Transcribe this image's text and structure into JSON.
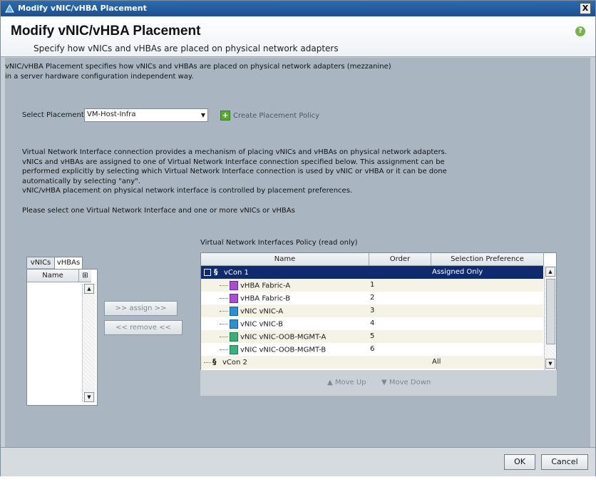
{
  "window": {
    "title": "Modify vNIC/vHBA Placement",
    "close_label": "X"
  },
  "header": {
    "title": "Modify vNIC/vHBA Placement",
    "subtitle": "Specify how vNICs and vHBAs are placed on physical network adapters",
    "help_label": "?"
  },
  "intro": {
    "line1": "vNIC/vHBA Placement specifies how vNICs and vHBAs are placed on physical network adapters (mezzanine)",
    "line2": "in a server hardware configuration independent way."
  },
  "placement": {
    "label": "Select Placement:",
    "selected": "VM-Host-Infra",
    "create_label": "Create Placement Policy"
  },
  "description": {
    "lines": [
      "Virtual Network Interface connection provides a mechanism of placing vNICs and vHBAs on physical network adapters.",
      "vNICs and vHBAs are assigned to one of Virtual Network Interface connection specified below. This assignment can be",
      "performed explicitly by selecting which Virtual Network Interface connection is used by vNIC or vHBA or it can be done",
      "automatically by selecting \"any\".",
      "vNIC/vHBA placement on physical network interface is controlled by placement preferences."
    ],
    "instruction": "Please select one Virtual Network Interface and one or more vNICs or vHBAs"
  },
  "left_panel": {
    "tabs": [
      "vNICs",
      "vHBAs"
    ],
    "active_tab": "vHBAs",
    "column_name": "Name"
  },
  "buttons": {
    "assign": ">> assign >>",
    "remove": "<< remove <<"
  },
  "vni_table": {
    "title": "Virtual Network Interfaces Policy (read only)",
    "columns": [
      "Name",
      "Order",
      "Selection Preference"
    ],
    "rows": [
      {
        "name": "vCon 1",
        "order": "",
        "pref": "Assigned Only",
        "type": "vcon"
      },
      {
        "name": "vHBA Fabric-A",
        "order": "1",
        "pref": "",
        "type": "vhba"
      },
      {
        "name": "vHBA Fabric-B",
        "order": "2",
        "pref": "",
        "type": "vhba"
      },
      {
        "name": "vNIC vNIC-A",
        "order": "3",
        "pref": "",
        "type": "vnic"
      },
      {
        "name": "vNIC vNIC-B",
        "order": "4",
        "pref": "",
        "type": "vnic"
      },
      {
        "name": "vNIC vNIC-OOB-MGMT-A",
        "order": "5",
        "pref": "",
        "type": "oob"
      },
      {
        "name": "vNIC vNIC-OOB-MGMT-B",
        "order": "6",
        "pref": "",
        "type": "oob"
      },
      {
        "name": "vCon 2",
        "order": "",
        "pref": "All",
        "type": "vcon"
      }
    ],
    "move_up": "Move Up",
    "move_down": "Move Down"
  },
  "footer": {
    "ok": "OK",
    "cancel": "Cancel"
  }
}
